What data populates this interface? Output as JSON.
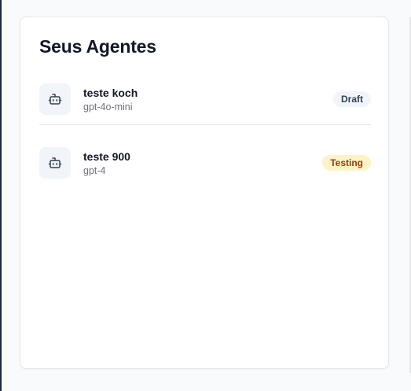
{
  "panel": {
    "title": "Seus Agentes"
  },
  "agents": [
    {
      "name": "teste koch",
      "model": "gpt-4o-mini",
      "status": "Draft",
      "icon": "bot-icon"
    },
    {
      "name": "teste 900",
      "model": "gpt-4",
      "status": "Testing",
      "icon": "bot-icon"
    }
  ],
  "colors": {
    "draft_badge_bg": "#f1f5f9",
    "testing_badge_bg": "#fef3c7",
    "testing_badge_text": "#92400e"
  }
}
